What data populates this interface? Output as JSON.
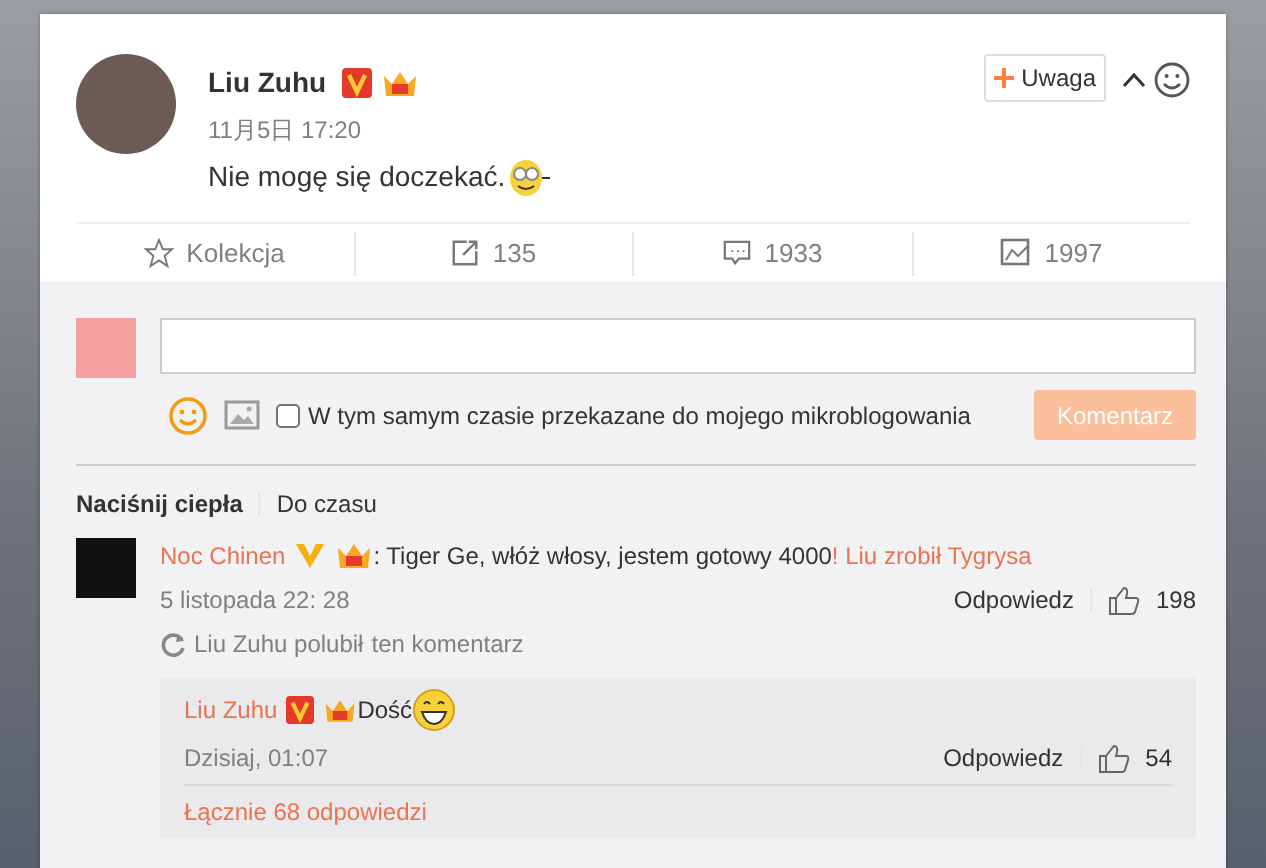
{
  "post": {
    "author": "Liu Zuhu",
    "time": "11月5日 17:20",
    "text": "Nie mogę się doczekać.",
    "follow_button": "Uwaga"
  },
  "actions": [
    {
      "kind": "favorite",
      "label": "Kolekcja"
    },
    {
      "kind": "repost",
      "label": "135"
    },
    {
      "kind": "comment",
      "label": "1933"
    },
    {
      "kind": "like",
      "label": "1997"
    }
  ],
  "compose": {
    "checkbox": {
      "label": "W tym samym czasie przekazane do mojego mikroblogowania",
      "checked": false
    },
    "submit": "Komentarz",
    "disabled": true
  },
  "comment_tabs": [
    {
      "label": "Naciśnij ciepła",
      "selected": true
    },
    {
      "label": "Do czasu",
      "selected": false
    }
  ],
  "comment": {
    "author": "Noc Chinen",
    "text": ": Tiger Ge, włóż włosy, jestem gotowy 4000 ",
    "link": "! Liu zrobił Tygrysa",
    "time": "5 listopada 22: 28",
    "reply": "Odpowiedz",
    "likes": "198",
    "liked_note": {
      "name": "Liu Zuhu polubił",
      "text": "ten komentarz"
    },
    "replies": [
      {
        "author": "Liu Zuhu",
        "text": "Dość",
        "time": "Dzisiaj, 01:07",
        "reply": "Odpowiedz",
        "likes": "54"
      }
    ],
    "total": "Łącznie 68 odpowiedzi"
  }
}
